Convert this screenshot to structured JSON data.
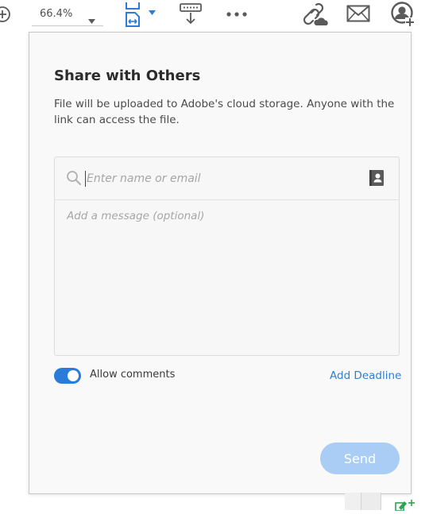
{
  "toolbar": {
    "zoom_value": "66.4%",
    "icons": [
      "zoom-in-icon",
      "fit-page-icon",
      "scroll-mode-icon",
      "more-icon",
      "share-link-icon",
      "email-icon",
      "share-with-others-icon"
    ],
    "accent_color": "#2b7bd8"
  },
  "share_dialog": {
    "title": "Share with Others",
    "description": "File will be uploaded to Adobe's cloud storage. Anyone with the link can access the file.",
    "recipient_placeholder": "Enter name or email",
    "message_placeholder": "Add a message (optional)",
    "allow_comments_label": "Allow comments",
    "allow_comments_enabled": true,
    "add_deadline_label": "Add Deadline",
    "send_label": "Send",
    "send_enabled": false,
    "colors": {
      "send_disabled_bg": "#a9cdf4",
      "link": "#2d7fd1",
      "toggle_on": "#2b7bd8"
    }
  }
}
